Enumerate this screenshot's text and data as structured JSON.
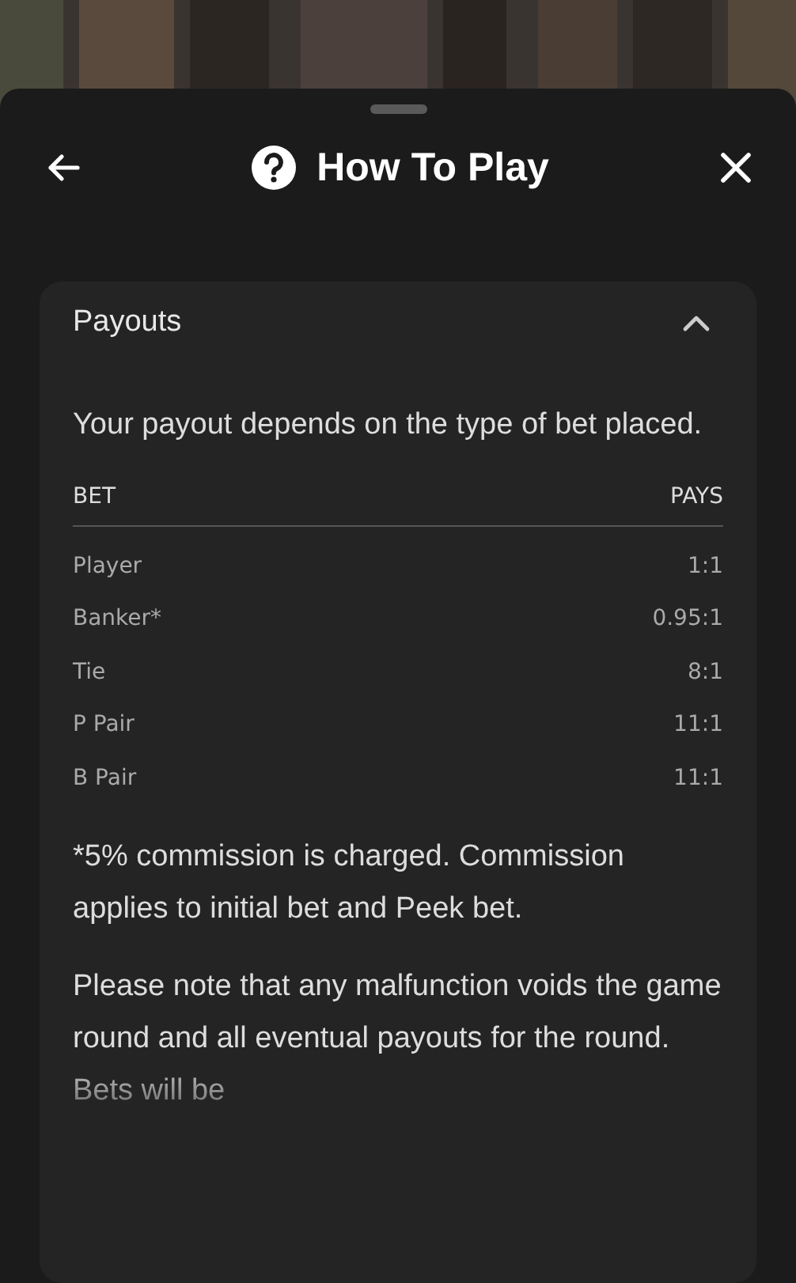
{
  "header": {
    "title": "How To Play"
  },
  "section": {
    "title": "Payouts",
    "expanded": true,
    "intro": "Your payout depends on the type of bet placed.",
    "table": {
      "columns": [
        "BET",
        "PAYS"
      ],
      "rows": [
        {
          "bet": "Player",
          "pays": "1:1"
        },
        {
          "bet": "Banker*",
          "pays": "0.95:1"
        },
        {
          "bet": "Tie",
          "pays": "8:1"
        },
        {
          "bet": "P Pair",
          "pays": "11:1"
        },
        {
          "bet": "B Pair",
          "pays": "11:1"
        }
      ]
    },
    "notes": [
      "*5% commission is charged. Commission applies to initial bet and Peek bet.",
      "Please note that any malfunction voids the game round and all eventual payouts for the round. Bets will be"
    ]
  }
}
